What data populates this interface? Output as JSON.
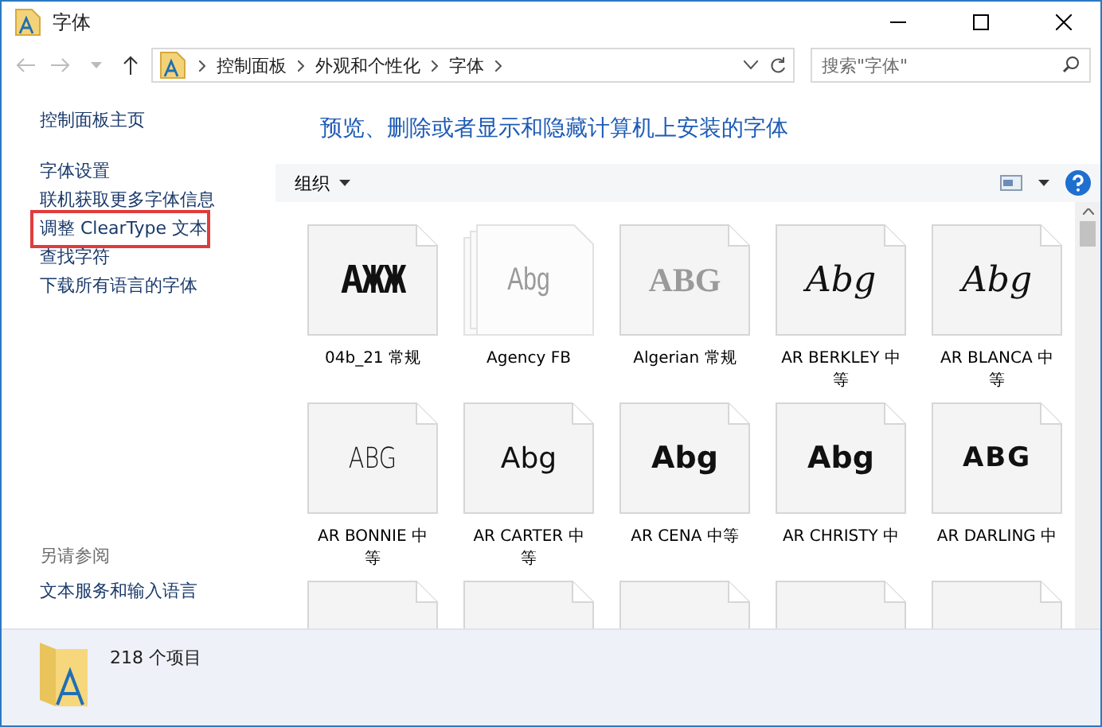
{
  "window": {
    "title": "字体"
  },
  "address": {
    "crumbs": [
      "控制面板",
      "外观和个性化",
      "字体"
    ]
  },
  "search": {
    "placeholder": "搜索\"字体\""
  },
  "sidebar": {
    "home": "控制面板主页",
    "items": [
      {
        "label": "字体设置",
        "highlighted": false
      },
      {
        "label": "联机获取更多字体信息",
        "highlighted": false
      },
      {
        "label": "调整 ClearType 文本",
        "highlighted": true
      },
      {
        "label": "查找字符",
        "highlighted": false
      },
      {
        "label": "下载所有语言的字体",
        "highlighted": false
      }
    ],
    "see_also_title": "另请参阅",
    "see_also": [
      "文本服务和输入语言"
    ]
  },
  "heading": "预览、删除或者显示和隐藏计算机上安装的字体",
  "toolbar": {
    "organize": "组织"
  },
  "fonts": [
    {
      "name": "04b_21 常规",
      "sample": "ΑЖЖ",
      "kind": "single",
      "hidden": false
    },
    {
      "name": "Agency FB",
      "sample": "Abg",
      "kind": "family",
      "hidden": true
    },
    {
      "name": "Algerian 常规",
      "sample": "ABG",
      "kind": "single",
      "hidden": true
    },
    {
      "name": "AR BERKLEY 中等",
      "sample": "Abg",
      "kind": "single",
      "hidden": false
    },
    {
      "name": "AR BLANCA 中等",
      "sample": "Abg",
      "kind": "single",
      "hidden": false
    },
    {
      "name": "AR BONNIE 中等",
      "sample": "ABG",
      "kind": "single",
      "hidden": false
    },
    {
      "name": "AR CARTER 中等",
      "sample": "Abg",
      "kind": "single",
      "hidden": false
    },
    {
      "name": "AR CENA 中等",
      "sample": "Abg",
      "kind": "single",
      "hidden": false
    },
    {
      "name": "AR CHRISTY 中",
      "sample": "Abg",
      "kind": "single",
      "hidden": false
    },
    {
      "name": "AR DARLING 中",
      "sample": "ABG",
      "kind": "single",
      "hidden": false
    }
  ],
  "more_tiles": [
    {
      "kind": "single"
    },
    {
      "kind": "single"
    },
    {
      "kind": "single"
    },
    {
      "kind": "single"
    },
    {
      "kind": "single"
    }
  ],
  "status_bar": {
    "count": "218 个项目"
  }
}
